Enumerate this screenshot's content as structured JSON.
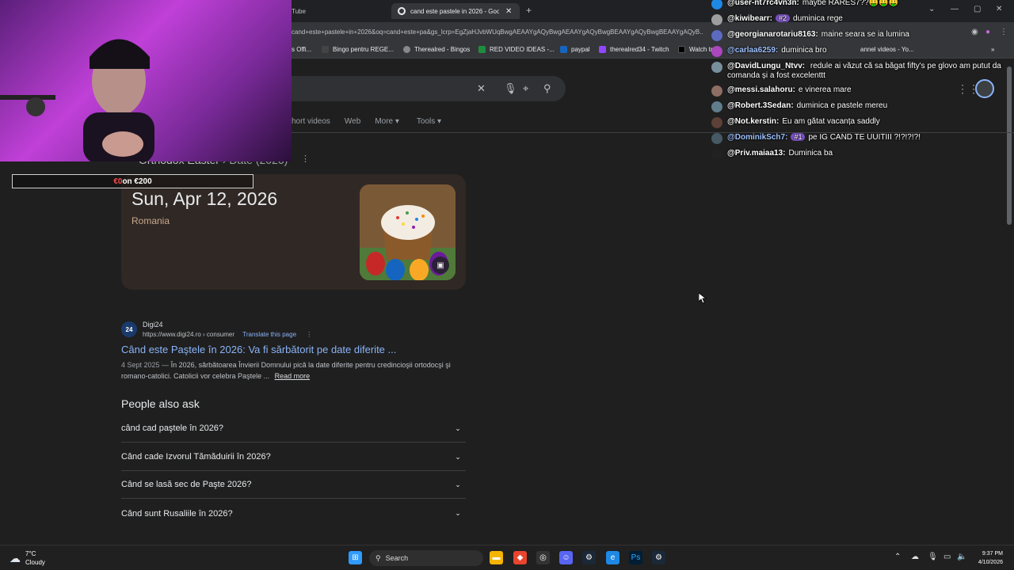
{
  "browser": {
    "tabs": [
      {
        "label": "Tube"
      },
      {
        "label": "cand este pastele in 2026 - Goo"
      }
    ],
    "url": "cand+este+pastele+in+2026&oq=cand+este+pa&gs_lcrp=EgZjaHJvbWUqBwgAEAAYgAQyBwgAEAAYgAQyBwgBEAAYgAQyBwgBEAAYgAQyB...",
    "bookmarks": [
      {
        "label": "s Offi..."
      },
      {
        "label": "Bingo pentru REGE..."
      },
      {
        "label": "Therealred - Bingos"
      },
      {
        "label": "RED VIDEO IDEAS -..."
      },
      {
        "label": "paypal"
      },
      {
        "label": "therealred34 - Twitch"
      },
      {
        "label": "Watch tr"
      },
      {
        "label": "annel videos - Yo..."
      }
    ]
  },
  "search": {
    "nav_tabs": [
      "hort videos",
      "Web",
      "More ▾",
      "Tools ▾"
    ]
  },
  "knowledge_panel": {
    "title": "Orthodox Easter",
    "subtitle": "› Date (2026)",
    "date": "Sun, Apr 12, 2026",
    "country": "Romania"
  },
  "result": {
    "favicon_text": "24",
    "site": "Digi24",
    "url": "https://www.digi24.ro › consumer",
    "translate": "Translate this page",
    "title": "Când este Paştele în 2026: Va fi sărbătorit pe date diferite ...",
    "date": "4 Sept 2025 —",
    "snippet": "În 2026, sărbătoarea Învierii Domnului pică la date diferite pentru credincioşii ortodocşi şi romano-catolici. Catolicii vor celebra Paştele ...",
    "read_more": "Read more"
  },
  "people_also_ask": {
    "title": "People also ask",
    "items": [
      "când cad paştele în 2026?",
      "Când cade Izvorul Tămăduirii în 2026?",
      "Când se lasă sec de Paşte 2026?",
      "Când sunt Rusaliile în 2026?"
    ]
  },
  "stream_goal": {
    "current": "€0",
    "rest": " on €200"
  },
  "chat": [
    {
      "user": "@user-nt7rc4vn3n:",
      "text": "maybe RARES7??🤑🤑🤑",
      "color": "#1e88e5"
    },
    {
      "user": "@kiwibearr:",
      "badge": "#2",
      "text": "duminica rege",
      "color": "#9e9e9e"
    },
    {
      "user": "@georgianarotariu8163:",
      "text": "maine seara se ia lumina",
      "color": "#5c6bc0"
    },
    {
      "user": "@carlaa6259:",
      "text": "duminica bro",
      "color": "#ab47bc"
    },
    {
      "user": "@DavidLungu_Ntvv:",
      "text": "redule ai văzut că sa băgat fifty's pe glovo am putut da comanda și a fost excelenttt",
      "color": "#78909c"
    },
    {
      "user": "@messi.salahoru:",
      "text": "e vinerea mare",
      "color": "#8d6e63"
    },
    {
      "user": "@Robert.3Sedan:",
      "text": "duminica e pastele mereu",
      "color": "#607d8b"
    },
    {
      "user": "@Not.kerstin:",
      "text": "Eu am gătat vacanța saddly",
      "color": "#5d4037"
    },
    {
      "user": "@DominikSch7:",
      "badge": "#1",
      "text": "pe IG CAND TE UUITIII ?!?!?!?!",
      "color": "#455a64"
    },
    {
      "user": "@Priv.maiaa13:",
      "text": "Duminica ba",
      "color": "#212121"
    }
  ],
  "taskbar": {
    "temp": "7°C",
    "condition": "Cloudy",
    "search_label": "Search",
    "time": "9:37 PM",
    "date": "4/10/2026"
  }
}
